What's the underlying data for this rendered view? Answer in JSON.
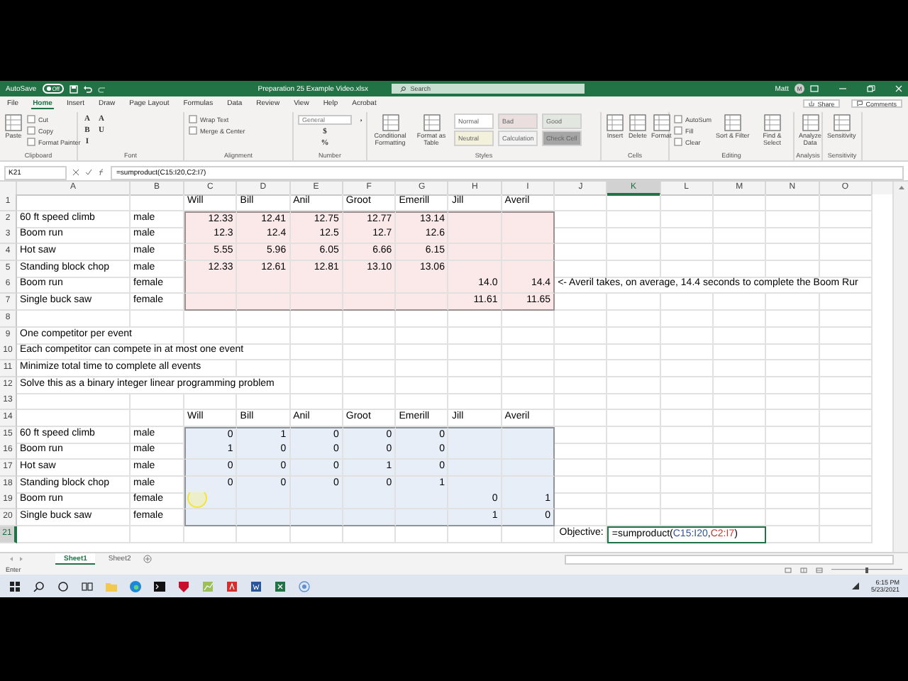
{
  "titlebar": {
    "autosave": {
      "label": "AutoSave",
      "toggle": "Off",
      "on": false
    },
    "title": "Preparation 25 Example Video.xlsx",
    "search": {
      "placeholder": "Search"
    },
    "user": "Matt",
    "avatar": "M"
  },
  "tabs": [
    {
      "label": "File",
      "selected": false
    },
    {
      "label": "Home",
      "selected": true
    },
    {
      "label": "Insert",
      "selected": false
    },
    {
      "label": "Draw",
      "selected": false
    },
    {
      "label": "Page Layout",
      "selected": false
    },
    {
      "label": "Formulas",
      "selected": false
    },
    {
      "label": "Data",
      "selected": false
    },
    {
      "label": "Review",
      "selected": false
    },
    {
      "label": "View",
      "selected": false
    },
    {
      "label": "Help",
      "selected": false
    },
    {
      "label": "Acrobat",
      "selected": false
    }
  ],
  "share": {
    "share": "Share",
    "comments": "Comments"
  },
  "ribbon": [
    {
      "label": "Clipboard",
      "items": [
        {
          "kind": "large",
          "label": "Paste"
        },
        {
          "kind": "small",
          "label": "Cut"
        },
        {
          "kind": "small",
          "label": "Copy"
        },
        {
          "kind": "small",
          "label": "Format Painter"
        }
      ]
    },
    {
      "label": "Font",
      "items": [
        {
          "kind": "glyph",
          "label": "A"
        },
        {
          "kind": "glyph",
          "label": "B"
        },
        {
          "kind": "glyph",
          "label": "I"
        },
        {
          "kind": "glyph",
          "label": "A"
        },
        {
          "kind": "glyph",
          "label": "U"
        }
      ]
    },
    {
      "label": "Alignment",
      "items": [
        {
          "kind": "small",
          "label": "Wrap Text"
        },
        {
          "kind": "small",
          "label": "Merge & Center"
        }
      ]
    },
    {
      "label": "Number",
      "items": [
        {
          "kind": "field",
          "label": "General"
        },
        {
          "kind": "glyph",
          "label": "$"
        },
        {
          "kind": "glyph",
          "label": "%"
        },
        {
          "kind": "glyph",
          "label": ","
        }
      ]
    },
    {
      "label": "Styles",
      "items": [
        {
          "kind": "large",
          "label": "Conditional Formatting"
        },
        {
          "kind": "large",
          "label": "Format as Table"
        },
        {
          "kind": "style",
          "label": "Normal",
          "color": "#ffffff"
        },
        {
          "kind": "style",
          "label": "Neutral",
          "color": "#f3f0dc"
        },
        {
          "kind": "style",
          "label": "Bad",
          "color": "#eadede"
        },
        {
          "kind": "style",
          "label": "Calculation",
          "color": "#f2f2f2"
        },
        {
          "kind": "style",
          "label": "Good",
          "color": "#e2e8e0"
        },
        {
          "kind": "style",
          "label": "Check Cell",
          "color": "#a5a5a5"
        }
      ]
    },
    {
      "label": "Cells",
      "items": [
        {
          "kind": "large",
          "label": "Insert"
        },
        {
          "kind": "large",
          "label": "Delete"
        },
        {
          "kind": "large",
          "label": "Format"
        }
      ]
    },
    {
      "label": "Editing",
      "items": [
        {
          "kind": "small",
          "label": "AutoSum"
        },
        {
          "kind": "small",
          "label": "Fill"
        },
        {
          "kind": "small",
          "label": "Clear"
        },
        {
          "kind": "large",
          "label": "Sort & Filter"
        },
        {
          "kind": "large",
          "label": "Find & Select"
        }
      ]
    },
    {
      "label": "Analysis",
      "items": [
        {
          "kind": "large",
          "label": "Analyze Data"
        }
      ]
    },
    {
      "label": "Sensitivity",
      "items": [
        {
          "kind": "large",
          "label": "Sensitivity"
        }
      ]
    }
  ],
  "formula_bar": {
    "name_box": "K21",
    "formula": "=sumproduct(C15:I20,C2:I7)"
  },
  "columns": [
    {
      "letter": "A",
      "selected": false
    },
    {
      "letter": "B",
      "selected": false
    },
    {
      "letter": "C",
      "selected": false
    },
    {
      "letter": "D",
      "selected": false
    },
    {
      "letter": "E",
      "selected": false
    },
    {
      "letter": "F",
      "selected": false
    },
    {
      "letter": "G",
      "selected": false
    },
    {
      "letter": "H",
      "selected": false
    },
    {
      "letter": "I",
      "selected": false
    },
    {
      "letter": "J",
      "selected": false
    },
    {
      "letter": "K",
      "selected": true
    },
    {
      "letter": "L",
      "selected": false
    },
    {
      "letter": "M",
      "selected": false
    },
    {
      "letter": "N",
      "selected": false
    },
    {
      "letter": "O",
      "selected": false
    }
  ],
  "rows": [
    {
      "num": "1",
      "selected": false,
      "cells": [
        null,
        null,
        {
          "kind": "text",
          "text": "Will"
        },
        {
          "kind": "text",
          "text": "Bill"
        },
        {
          "kind": "text",
          "text": "Anil"
        },
        {
          "kind": "text",
          "text": "Groot"
        },
        {
          "kind": "text",
          "text": "Emerill"
        },
        {
          "kind": "text",
          "text": "Jill"
        },
        {
          "kind": "text",
          "text": "Averil"
        }
      ]
    },
    {
      "num": "2",
      "selected": false,
      "cells": [
        {
          "kind": "text",
          "text": "60 ft speed climb"
        },
        {
          "kind": "text",
          "text": "male"
        },
        {
          "kind": "number",
          "text": "12.33",
          "color": "#fbe9e9"
        },
        {
          "kind": "number",
          "text": "12.41",
          "color": "#fbe9e9"
        },
        {
          "kind": "number",
          "text": "12.75",
          "color": "#fbe9e9"
        },
        {
          "kind": "number",
          "text": "12.77",
          "color": "#fbe9e9"
        },
        {
          "kind": "number",
          "text": "13.14",
          "color": "#fbe9e9"
        },
        {
          "kind": "blank",
          "color": "#fbe9e9"
        },
        {
          "kind": "blank",
          "color": "#fbe9e9"
        }
      ]
    },
    {
      "num": "3",
      "selected": false,
      "cells": [
        {
          "kind": "text",
          "text": "Boom run"
        },
        {
          "kind": "text",
          "text": "male"
        },
        {
          "kind": "number",
          "text": "12.3",
          "color": "#fbe9e9"
        },
        {
          "kind": "number",
          "text": "12.4",
          "color": "#fbe9e9"
        },
        {
          "kind": "number",
          "text": "12.5",
          "color": "#fbe9e9"
        },
        {
          "kind": "number",
          "text": "12.7",
          "color": "#fbe9e9"
        },
        {
          "kind": "number",
          "text": "12.6",
          "color": "#fbe9e9"
        },
        {
          "kind": "blank",
          "color": "#fbe9e9"
        },
        {
          "kind": "blank",
          "color": "#fbe9e9"
        }
      ]
    },
    {
      "num": "4",
      "selected": false,
      "cells": [
        {
          "kind": "text",
          "text": "Hot saw"
        },
        {
          "kind": "text",
          "text": "male"
        },
        {
          "kind": "number",
          "text": "5.55",
          "color": "#fbe9e9"
        },
        {
          "kind": "number",
          "text": "5.96",
          "color": "#fbe9e9"
        },
        {
          "kind": "number",
          "text": "6.05",
          "color": "#fbe9e9"
        },
        {
          "kind": "number",
          "text": "6.66",
          "color": "#fbe9e9"
        },
        {
          "kind": "number",
          "text": "6.15",
          "color": "#fbe9e9"
        },
        {
          "kind": "blank",
          "color": "#fbe9e9"
        },
        {
          "kind": "blank",
          "color": "#fbe9e9"
        }
      ]
    },
    {
      "num": "5",
      "selected": false,
      "cells": [
        {
          "kind": "text",
          "text": "Standing block chop"
        },
        {
          "kind": "text",
          "text": "male"
        },
        {
          "kind": "number",
          "text": "12.33",
          "color": "#fbe9e9"
        },
        {
          "kind": "number",
          "text": "12.61",
          "color": "#fbe9e9"
        },
        {
          "kind": "number",
          "text": "12.81",
          "color": "#fbe9e9"
        },
        {
          "kind": "number",
          "text": "13.10",
          "color": "#fbe9e9"
        },
        {
          "kind": "number",
          "text": "13.06",
          "color": "#fbe9e9"
        },
        {
          "kind": "blank",
          "color": "#fbe9e9"
        },
        {
          "kind": "blank",
          "color": "#fbe9e9"
        }
      ]
    },
    {
      "num": "6",
      "selected": false,
      "cells": [
        {
          "kind": "text",
          "text": "Boom run"
        },
        {
          "kind": "text",
          "text": "female"
        },
        {
          "kind": "blank",
          "color": "#fbe9e9"
        },
        {
          "kind": "blank",
          "color": "#fbe9e9"
        },
        {
          "kind": "blank",
          "color": "#fbe9e9"
        },
        {
          "kind": "blank",
          "color": "#fbe9e9"
        },
        {
          "kind": "blank",
          "color": "#fbe9e9"
        },
        {
          "kind": "number",
          "text": "14.0",
          "color": "#fbe9e9"
        },
        {
          "kind": "number",
          "text": "14.4",
          "color": "#fbe9e9"
        },
        {
          "kind": "text",
          "text": "<- Averil takes, on average, 14.4 seconds to complete the Boom Rur"
        }
      ]
    },
    {
      "num": "7",
      "selected": false,
      "cells": [
        {
          "kind": "text",
          "text": "Single buck saw"
        },
        {
          "kind": "text",
          "text": "female"
        },
        {
          "kind": "blank",
          "color": "#fbe9e9"
        },
        {
          "kind": "blank",
          "color": "#fbe9e9"
        },
        {
          "kind": "blank",
          "color": "#fbe9e9"
        },
        {
          "kind": "blank",
          "color": "#fbe9e9"
        },
        {
          "kind": "blank",
          "color": "#fbe9e9"
        },
        {
          "kind": "number",
          "text": "11.61",
          "color": "#fbe9e9"
        },
        {
          "kind": "number",
          "text": "11.65",
          "color": "#fbe9e9"
        }
      ]
    },
    {
      "num": "8",
      "selected": false,
      "cells": []
    },
    {
      "num": "9",
      "selected": false,
      "cells": [
        {
          "kind": "text",
          "text": "One competitor per event"
        }
      ]
    },
    {
      "num": "10",
      "selected": false,
      "cells": [
        {
          "kind": "text",
          "text": "Each competitor can compete in at most one event"
        }
      ]
    },
    {
      "num": "11",
      "selected": false,
      "cells": [
        {
          "kind": "text",
          "text": "Minimize total time to complete all events"
        }
      ]
    },
    {
      "num": "12",
      "selected": false,
      "cells": [
        {
          "kind": "text",
          "text": "Solve this as a binary integer linear programming problem"
        }
      ]
    },
    {
      "num": "13",
      "selected": false,
      "cells": []
    },
    {
      "num": "14",
      "selected": false,
      "cells": [
        null,
        null,
        {
          "kind": "text",
          "text": "Will"
        },
        {
          "kind": "text",
          "text": "Bill"
        },
        {
          "kind": "text",
          "text": "Anil"
        },
        {
          "kind": "text",
          "text": "Groot"
        },
        {
          "kind": "text",
          "text": "Emerill"
        },
        {
          "kind": "text",
          "text": "Jill"
        },
        {
          "kind": "text",
          "text": "Averil"
        }
      ]
    },
    {
      "num": "15",
      "selected": false,
      "cells": [
        {
          "kind": "text",
          "text": "60 ft speed climb"
        },
        {
          "kind": "text",
          "text": "male"
        },
        {
          "kind": "number",
          "text": "0",
          "color": "#e7eef7"
        },
        {
          "kind": "number",
          "text": "1",
          "color": "#e7eef7"
        },
        {
          "kind": "number",
          "text": "0",
          "color": "#e7eef7"
        },
        {
          "kind": "number",
          "text": "0",
          "color": "#e7eef7"
        },
        {
          "kind": "number",
          "text": "0",
          "color": "#e7eef7"
        },
        {
          "kind": "blank",
          "color": "#e7eef7"
        },
        {
          "kind": "blank",
          "color": "#e7eef7"
        }
      ]
    },
    {
      "num": "16",
      "selected": false,
      "cells": [
        {
          "kind": "text",
          "text": "Boom run"
        },
        {
          "kind": "text",
          "text": "male"
        },
        {
          "kind": "number",
          "text": "1",
          "color": "#e7eef7"
        },
        {
          "kind": "number",
          "text": "0",
          "color": "#e7eef7"
        },
        {
          "kind": "number",
          "text": "0",
          "color": "#e7eef7"
        },
        {
          "kind": "number",
          "text": "0",
          "color": "#e7eef7"
        },
        {
          "kind": "number",
          "text": "0",
          "color": "#e7eef7"
        },
        {
          "kind": "blank",
          "color": "#e7eef7"
        },
        {
          "kind": "blank",
          "color": "#e7eef7"
        }
      ]
    },
    {
      "num": "17",
      "selected": false,
      "cells": [
        {
          "kind": "text",
          "text": "Hot saw"
        },
        {
          "kind": "text",
          "text": "male"
        },
        {
          "kind": "number",
          "text": "0",
          "color": "#e7eef7"
        },
        {
          "kind": "number",
          "text": "0",
          "color": "#e7eef7"
        },
        {
          "kind": "number",
          "text": "0",
          "color": "#e7eef7"
        },
        {
          "kind": "number",
          "text": "1",
          "color": "#e7eef7"
        },
        {
          "kind": "number",
          "text": "0",
          "color": "#e7eef7"
        },
        {
          "kind": "blank",
          "color": "#e7eef7"
        },
        {
          "kind": "blank",
          "color": "#e7eef7"
        }
      ]
    },
    {
      "num": "18",
      "selected": false,
      "cells": [
        {
          "kind": "text",
          "text": "Standing block chop"
        },
        {
          "kind": "text",
          "text": "male"
        },
        {
          "kind": "number",
          "text": "0",
          "color": "#e7eef7"
        },
        {
          "kind": "number",
          "text": "0",
          "color": "#e7eef7"
        },
        {
          "kind": "number",
          "text": "0",
          "color": "#e7eef7"
        },
        {
          "kind": "number",
          "text": "0",
          "color": "#e7eef7"
        },
        {
          "kind": "number",
          "text": "1",
          "color": "#e7eef7"
        },
        {
          "kind": "blank",
          "color": "#e7eef7"
        },
        {
          "kind": "blank",
          "color": "#e7eef7"
        }
      ]
    },
    {
      "num": "19",
      "selected": false,
      "cells": [
        {
          "kind": "text",
          "text": "Boom run"
        },
        {
          "kind": "text",
          "text": "female"
        },
        {
          "kind": "blank",
          "color": "#e7eef7",
          "pointer": true
        },
        {
          "kind": "blank",
          "color": "#e7eef7"
        },
        {
          "kind": "blank",
          "color": "#e7eef7"
        },
        {
          "kind": "blank",
          "color": "#e7eef7"
        },
        {
          "kind": "blank",
          "color": "#e7eef7"
        },
        {
          "kind": "number",
          "text": "0",
          "color": "#e7eef7"
        },
        {
          "kind": "number",
          "text": "1",
          "color": "#e7eef7"
        }
      ]
    },
    {
      "num": "20",
      "selected": false,
      "cells": [
        {
          "kind": "text",
          "text": "Single buck saw"
        },
        {
          "kind": "text",
          "text": "female"
        },
        {
          "kind": "blank",
          "color": "#e7eef7"
        },
        {
          "kind": "blank",
          "color": "#e7eef7"
        },
        {
          "kind": "blank",
          "color": "#e7eef7"
        },
        {
          "kind": "blank",
          "color": "#e7eef7"
        },
        {
          "kind": "blank",
          "color": "#e7eef7"
        },
        {
          "kind": "number",
          "text": "1",
          "color": "#e7eef7"
        },
        {
          "kind": "number",
          "text": "0",
          "color": "#e7eef7"
        }
      ]
    },
    {
      "num": "21",
      "selected": true,
      "cells": [
        null,
        null,
        null,
        null,
        null,
        null,
        null,
        null,
        null,
        {
          "kind": "label",
          "text": "Objective:"
        },
        {
          "kind": "formula",
          "active": true,
          "parts": [
            {
              "text": "=sumproduct("
            },
            {
              "text": "C15:I20",
              "color": "#2f5597"
            },
            {
              "text": ","
            },
            {
              "text": "C2:I7",
              "color": "#c0392b"
            },
            {
              "text": ")"
            }
          ]
        }
      ]
    }
  ],
  "sheets": [
    {
      "label": "Sheet1",
      "selected": true
    },
    {
      "label": "Sheet2",
      "selected": false
    }
  ],
  "status": "Enter",
  "zoom": {
    "level": 0.5
  },
  "taskbar": {
    "time": "6:15 PM",
    "date": "5/23/2021"
  }
}
